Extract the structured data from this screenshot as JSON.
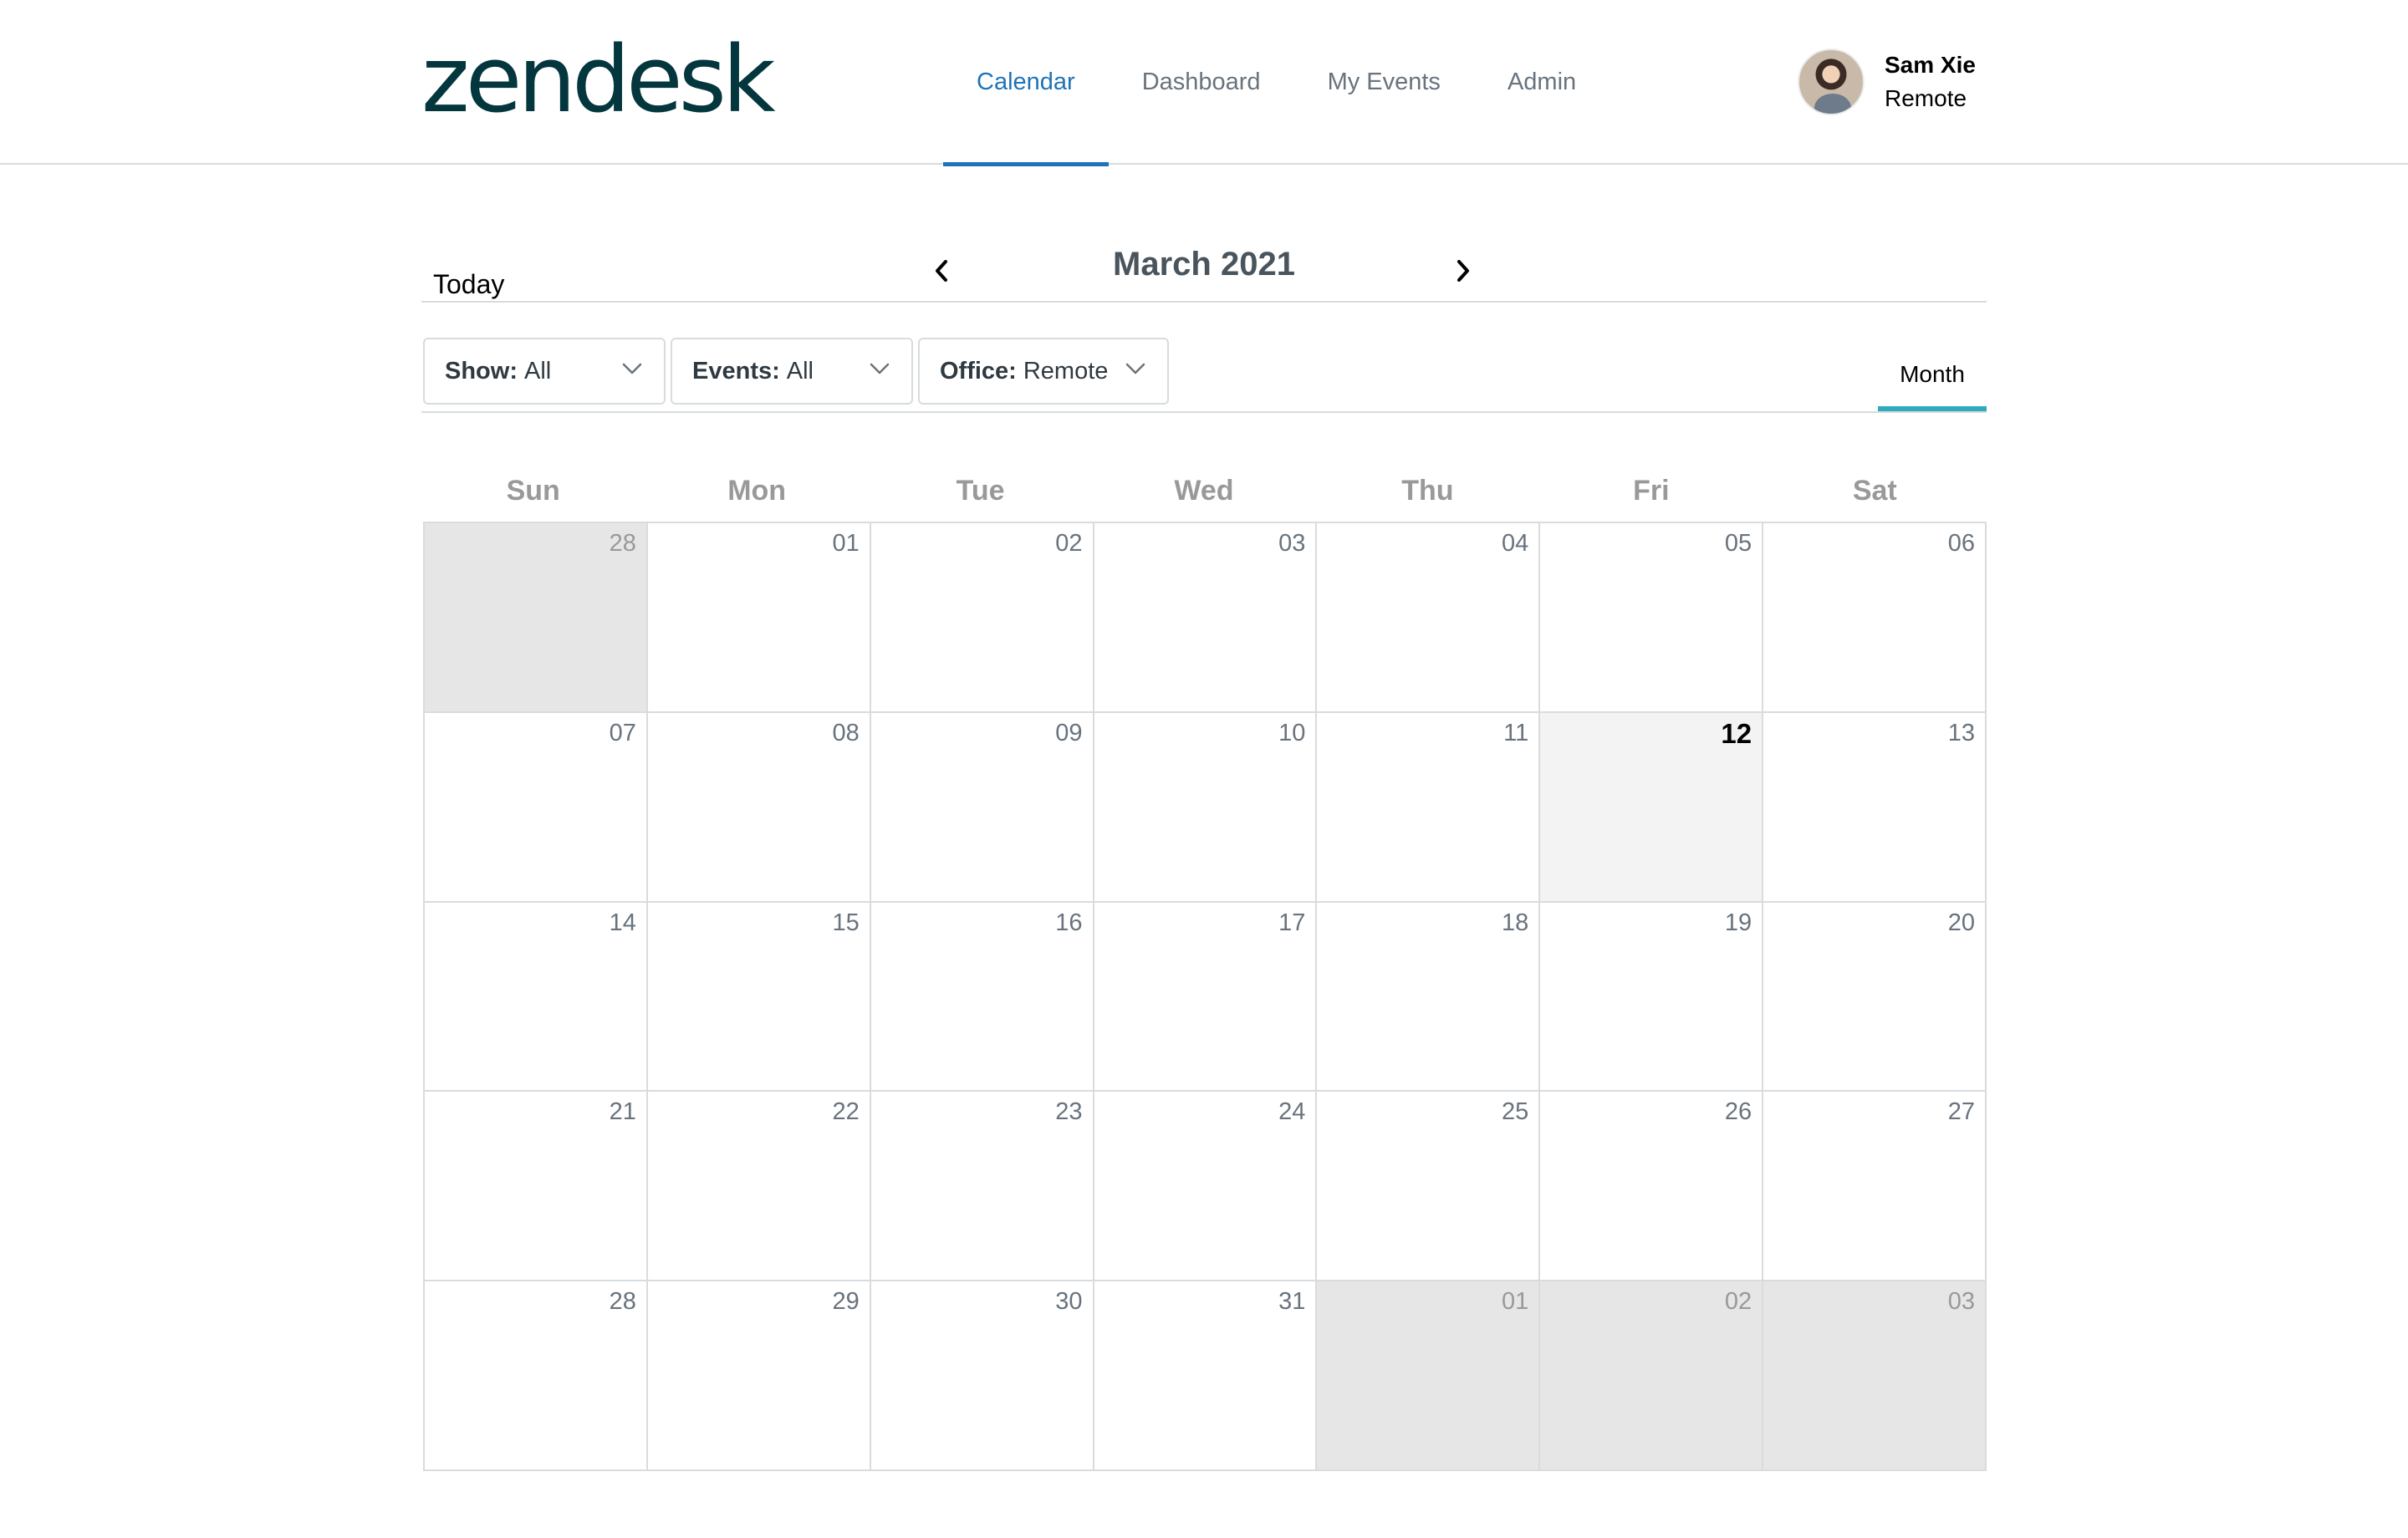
{
  "app": {
    "logo_text": "zendesk",
    "brand_color": "#03363d",
    "accent_color": "#1f73b7",
    "tab_accent_color": "#30aabc"
  },
  "nav": {
    "items": [
      {
        "label": "Calendar",
        "active": true
      },
      {
        "label": "Dashboard",
        "active": false
      },
      {
        "label": "My Events",
        "active": false
      },
      {
        "label": "Admin",
        "active": false
      }
    ]
  },
  "user": {
    "name": "Sam Xie",
    "office": "Remote",
    "avatar_icon": "user-avatar"
  },
  "calendar": {
    "today_label": "Today",
    "title": "March 2021",
    "prev_icon": "chevron-left-icon",
    "next_icon": "chevron-right-icon",
    "view_label": "Month",
    "weekdays": [
      "Sun",
      "Mon",
      "Tue",
      "Wed",
      "Thu",
      "Fri",
      "Sat"
    ],
    "weeks": [
      [
        {
          "day": "28",
          "other": true
        },
        {
          "day": "01"
        },
        {
          "day": "02"
        },
        {
          "day": "03"
        },
        {
          "day": "04"
        },
        {
          "day": "05"
        },
        {
          "day": "06"
        }
      ],
      [
        {
          "day": "07"
        },
        {
          "day": "08"
        },
        {
          "day": "09"
        },
        {
          "day": "10"
        },
        {
          "day": "11"
        },
        {
          "day": "12",
          "today": true
        },
        {
          "day": "13"
        }
      ],
      [
        {
          "day": "14"
        },
        {
          "day": "15"
        },
        {
          "day": "16"
        },
        {
          "day": "17"
        },
        {
          "day": "18"
        },
        {
          "day": "19"
        },
        {
          "day": "20"
        }
      ],
      [
        {
          "day": "21"
        },
        {
          "day": "22"
        },
        {
          "day": "23"
        },
        {
          "day": "24"
        },
        {
          "day": "25"
        },
        {
          "day": "26"
        },
        {
          "day": "27"
        }
      ],
      [
        {
          "day": "28"
        },
        {
          "day": "29"
        },
        {
          "day": "30"
        },
        {
          "day": "31"
        },
        {
          "day": "01",
          "other": true
        },
        {
          "day": "02",
          "other": true
        },
        {
          "day": "03",
          "other": true
        }
      ]
    ]
  },
  "filters": {
    "show": {
      "label": "Show:",
      "value": "All"
    },
    "events": {
      "label": "Events:",
      "value": "All"
    },
    "office": {
      "label": "Office:",
      "value": "Remote"
    }
  }
}
